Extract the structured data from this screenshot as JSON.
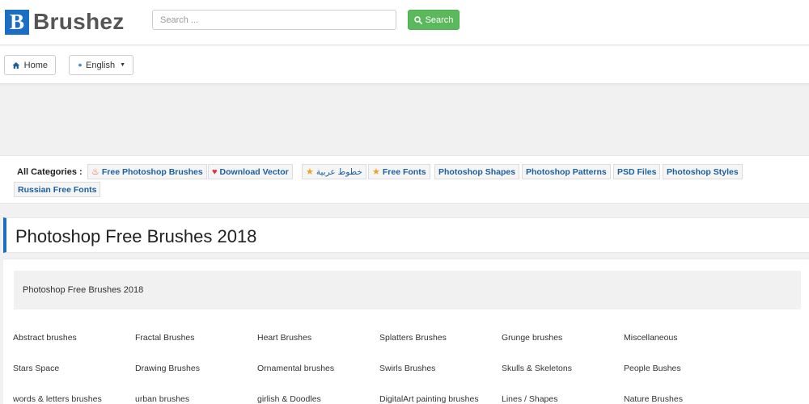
{
  "header": {
    "logo_mark": "B",
    "logo_text": "Brushez",
    "search_placeholder": "Search ...",
    "search_label": "Search"
  },
  "nav": {
    "home_label": "Home",
    "language_label": "English"
  },
  "categories": {
    "label": "All Categories :",
    "items": [
      {
        "label": "Free Photoshop Brushes",
        "icon": "flame-icon"
      },
      {
        "label": "Download Vector",
        "icon": "heart-icon"
      },
      {
        "label": "خطوط عربية",
        "icon": "star-icon"
      },
      {
        "label": "Free Fonts",
        "icon": "star-icon"
      },
      {
        "label": "Photoshop Shapes",
        "icon": ""
      },
      {
        "label": "Photoshop Patterns",
        "icon": ""
      },
      {
        "label": "PSD Files",
        "icon": ""
      },
      {
        "label": "Photoshop Styles",
        "icon": ""
      },
      {
        "label": "Russian Free Fonts",
        "icon": ""
      }
    ]
  },
  "page": {
    "title": "Photoshop Free Brushes 2018",
    "description": "Photoshop Free Brushes 2018"
  },
  "links": [
    [
      "Abstract brushes",
      "Fractal Brushes",
      "Heart Brushes",
      "Splatters Brushes",
      "Grunge brushes",
      "Miscellaneous"
    ],
    [
      "Stars Space",
      "Drawing Brushes",
      "Ornamental brushes",
      "Swirls Brushes",
      "Skulls & Skeletons",
      "People Bushes"
    ],
    [
      "words & letters brushes",
      "urban brushes",
      "girlish & Doodles",
      "DigitalArt painting brushes",
      "Lines / Shapes",
      "Nature Brushes"
    ]
  ],
  "colors": {
    "brand": "#1a6fc4",
    "search_button": "#5cb85c",
    "category_link": "#1a5f9e"
  }
}
